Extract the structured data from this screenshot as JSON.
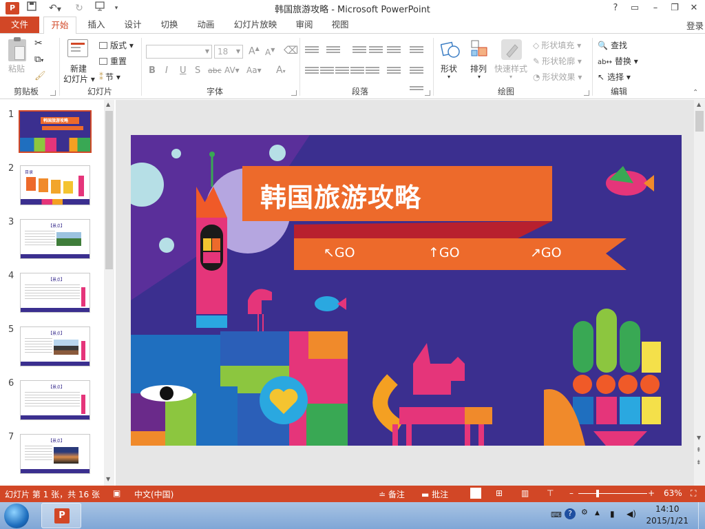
{
  "window": {
    "title": "韩国旅游攻略 - Microsoft PowerPoint",
    "help": "?",
    "app_logo": "P"
  },
  "ribbon_tabs": [
    "文件",
    "开始",
    "插入",
    "设计",
    "切换",
    "动画",
    "幻灯片放映",
    "审阅",
    "视图"
  ],
  "login": "登录",
  "ribbon": {
    "clipboard": {
      "label": "剪贴板",
      "paste": "粘贴"
    },
    "slides": {
      "label": "幻灯片",
      "new_slide_1": "新建",
      "new_slide_2": "幻灯片",
      "layout": "版式",
      "reset": "重置",
      "section": "节"
    },
    "font": {
      "label": "字体",
      "font_size": "18",
      "grow": "A",
      "shrink": "A",
      "bold": "B",
      "italic": "I",
      "underline": "U",
      "shadow": "S",
      "strike": "abc",
      "spacing": "AV",
      "case": "Aa",
      "color": "A"
    },
    "paragraph": {
      "label": "段落"
    },
    "drawing": {
      "label": "绘图",
      "shapes": "形状",
      "arrange": "排列",
      "quick_styles": "快速样式",
      "fill": "形状填充",
      "outline": "形状轮廓",
      "effects": "形状效果"
    },
    "editing": {
      "label": "编辑",
      "find": "查找",
      "replace": "替换",
      "select": "选择"
    }
  },
  "thumbnails": [
    {
      "num": "1",
      "title": "韩国旅游攻略"
    },
    {
      "num": "2",
      "title": "目录"
    },
    {
      "num": "3",
      "title": "【景点】"
    },
    {
      "num": "4",
      "title": "【景点】"
    },
    {
      "num": "5",
      "title": "【景点】"
    },
    {
      "num": "6",
      "title": "【景点】"
    },
    {
      "num": "7",
      "title": "【景点】"
    }
  ],
  "slide": {
    "title": "韩国旅游攻略",
    "go_buttons": [
      "↖GO",
      "↑GO",
      "↗GO"
    ],
    "colors": {
      "background": "#3b2f8f",
      "banner": "#ed6a2b",
      "banner_dark": "#c0392b"
    }
  },
  "status": {
    "slide_info": "幻灯片 第 1 张，共 16 张",
    "language": "中文(中国)",
    "notes": "备注",
    "comments": "批注",
    "zoom": "63%"
  },
  "taskbar": {
    "time": "14:10",
    "date": "2015/1/21"
  },
  "colors": {
    "accent": "#d24726",
    "status_bar": "#d24726"
  }
}
